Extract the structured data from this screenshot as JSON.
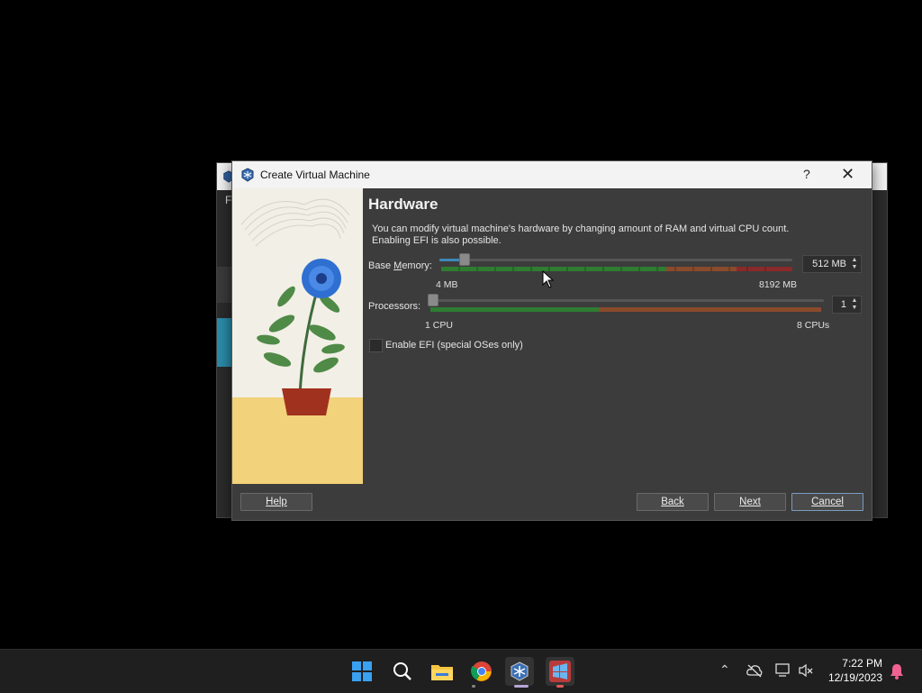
{
  "background_window": {
    "menu_letter": "F"
  },
  "dialog": {
    "title": "Create Virtual Machine",
    "help_glyph": "?",
    "close_glyph": "✕",
    "heading": "Hardware",
    "description_line1": "You can modify virtual machine's hardware by changing amount of RAM and virtual CPU count.",
    "description_line2": "Enabling EFI is also possible.",
    "memory": {
      "label_prefix": "Base ",
      "label_mnemonic": "M",
      "label_suffix": "emory:",
      "value": "512 MB",
      "min_label": "4 MB",
      "max_label": "8192 MB",
      "level": 0.062
    },
    "processors": {
      "label": "Processors:",
      "value": "1",
      "min_label": "1 CPU",
      "max_label": "8 CPUs",
      "level": 0
    },
    "efi": {
      "label": "Enable EFI (special OSes only)",
      "checked": false
    },
    "buttons": {
      "help": "Help",
      "back": "Back",
      "next": "Next",
      "cancel": "Cancel"
    }
  },
  "taskbar": {
    "apps": [
      {
        "name": "start-icon"
      },
      {
        "name": "search-icon"
      },
      {
        "name": "file-explorer-icon"
      },
      {
        "name": "chrome-icon"
      },
      {
        "name": "virtualbox-icon"
      },
      {
        "name": "windows-xp-app-icon"
      }
    ],
    "time": "7:22 PM",
    "date": "12/19/2023"
  },
  "colors": {
    "dialog_bg": "#3c3c3c",
    "slider_green": "#2e7d32",
    "slider_orange": "#8a4a2c",
    "slider_red": "#8a2a2a",
    "accent_blue": "#3d88b8"
  }
}
